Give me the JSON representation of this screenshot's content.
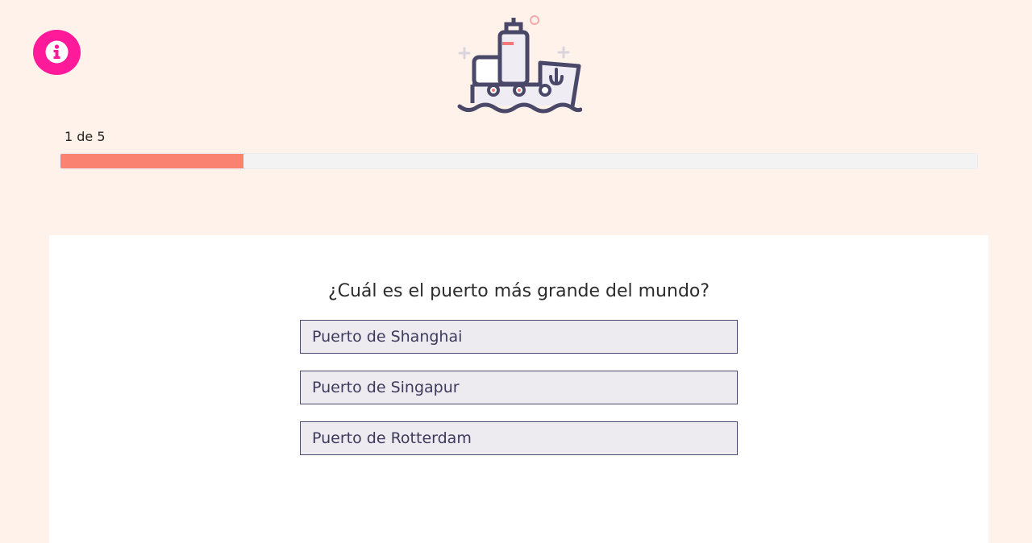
{
  "header": {
    "info_icon": "info-icon",
    "logo_icon": "ship-icon",
    "brand_color": "#ff1a9a"
  },
  "progress": {
    "label": "1 de 5",
    "current": 1,
    "total": 5,
    "fraction": 0.2,
    "fill_color": "#fa8270"
  },
  "quiz": {
    "question": "¿Cuál es el puerto más grande del mundo?",
    "answers": [
      "Puerto de Shanghai",
      "Puerto de Singapur",
      "Puerto de Rotterdam"
    ]
  }
}
